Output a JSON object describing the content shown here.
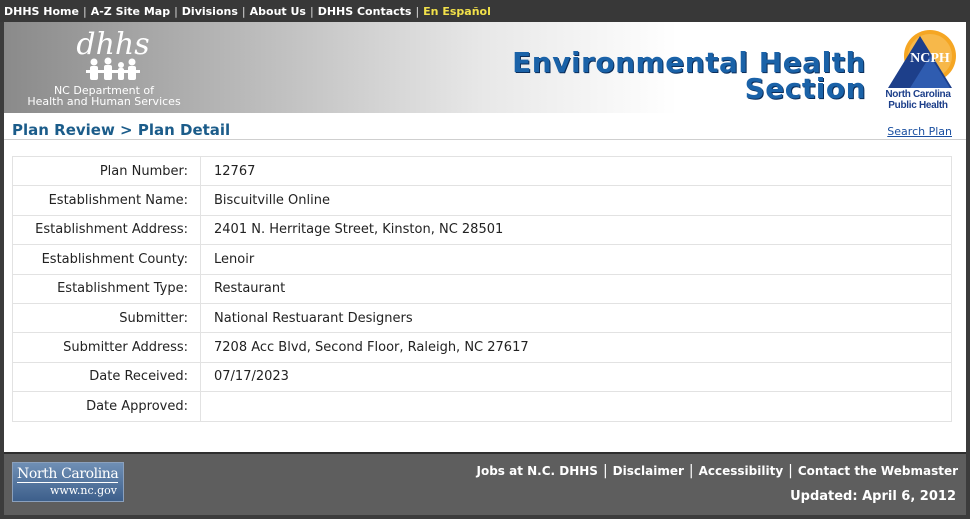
{
  "topnav": {
    "items": [
      "DHHS Home",
      "A-Z Site Map",
      "Divisions",
      "About Us",
      "DHHS Contacts"
    ],
    "spanish": "En Español"
  },
  "banner": {
    "agency_line1": "NC Department of",
    "agency_line2": "Health and Human Services",
    "title_line1": "Environmental Health",
    "title_line2": "Section",
    "ncph_badge": "NCPH",
    "ncph_line1": "North Carolina",
    "ncph_line2": "Public Health"
  },
  "breadcrumb": "Plan Review > Plan Detail",
  "search_plan": "Search Plan",
  "plan": {
    "rows": [
      {
        "label": "Plan Number:",
        "value": "12767"
      },
      {
        "label": "Establishment Name:",
        "value": "Biscuitville Online"
      },
      {
        "label": "Establishment Address:",
        "value": "2401 N. Herritage Street, Kinston, NC 28501"
      },
      {
        "label": "Establishment County:",
        "value": "Lenoir"
      },
      {
        "label": "Establishment Type:",
        "value": "Restaurant"
      },
      {
        "label": "Submitter:",
        "value": "National Restuarant Designers"
      },
      {
        "label": "Submitter Address:",
        "value": "7208 Acc Blvd, Second Floor, Raleigh, NC 27617"
      },
      {
        "label": "Date Received:",
        "value": "07/17/2023"
      },
      {
        "label": "Date Approved:",
        "value": ""
      }
    ]
  },
  "footer": {
    "nc_logo_line1": "North Carolina",
    "nc_logo_line2": "www.nc.gov",
    "links": [
      "Jobs at N.C. DHHS",
      "Disclaimer",
      "Accessibility",
      "Contact the Webmaster"
    ],
    "updated": "Updated: April 6, 2012"
  },
  "colors": {
    "title_blue": "#1a62a8",
    "breadcrumb_blue": "#1b5c8a",
    "spanish_yellow": "#f2e14a",
    "footer_gray": "#5e5e5e"
  }
}
